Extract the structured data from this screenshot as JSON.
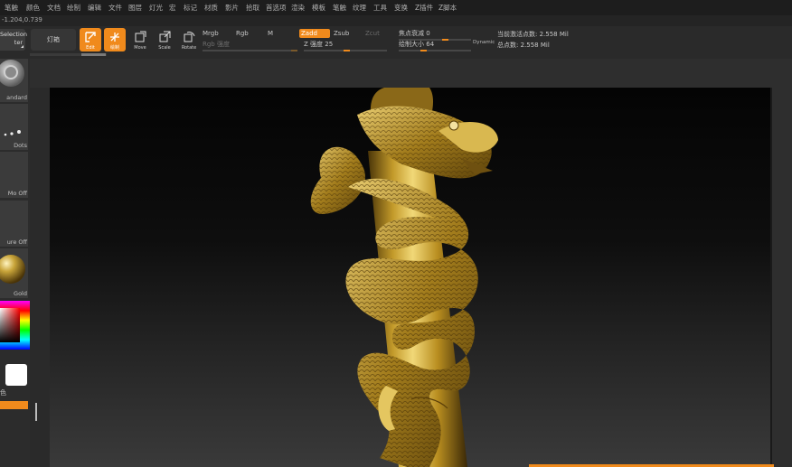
{
  "menu": [
    "笔触",
    "颜色",
    "文档",
    "绘制",
    "编辑",
    "文件",
    "图层",
    "灯光",
    "宏",
    "标记",
    "材质",
    "影片",
    "拾取",
    "首选项",
    "渲染",
    "模板",
    "笔触",
    "纹理",
    "工具",
    "变换",
    "Z插件",
    "Z脚本"
  ],
  "coords": "-1.204,0.739",
  "left_box_label": "Selection\nter",
  "light_button": "灯箱",
  "tool_buttons": [
    "Edit",
    "绘制",
    "Move",
    "Scale",
    "Rotate"
  ],
  "modes": {
    "mrgb": "Mrgb",
    "rgb": "Rgb",
    "m": "M",
    "zadd": "Zadd",
    "zsub": "Zsub",
    "zcut": "Zcut"
  },
  "sliders": {
    "rgb_intensity_label": "Rgb 强度",
    "z_intensity_label": "Z 强度",
    "z_intensity": 25,
    "focal_shift_label": "焦点衰减",
    "focal_shift": 0,
    "draw_size_label": "绘制大小",
    "draw_size": 64,
    "dynamic": "Dynamic"
  },
  "stats": {
    "active_points": "当前激活点数: 2.558 Mil",
    "total_points": "总点数: 2.558 Mil"
  },
  "left_tiles": [
    "andard",
    "Dots",
    "Mo Off",
    "ure Off",
    "Gold"
  ],
  "left_misc_label": "色",
  "colors": {
    "accent": "#f08a1c",
    "gold": "#c9a53a"
  }
}
